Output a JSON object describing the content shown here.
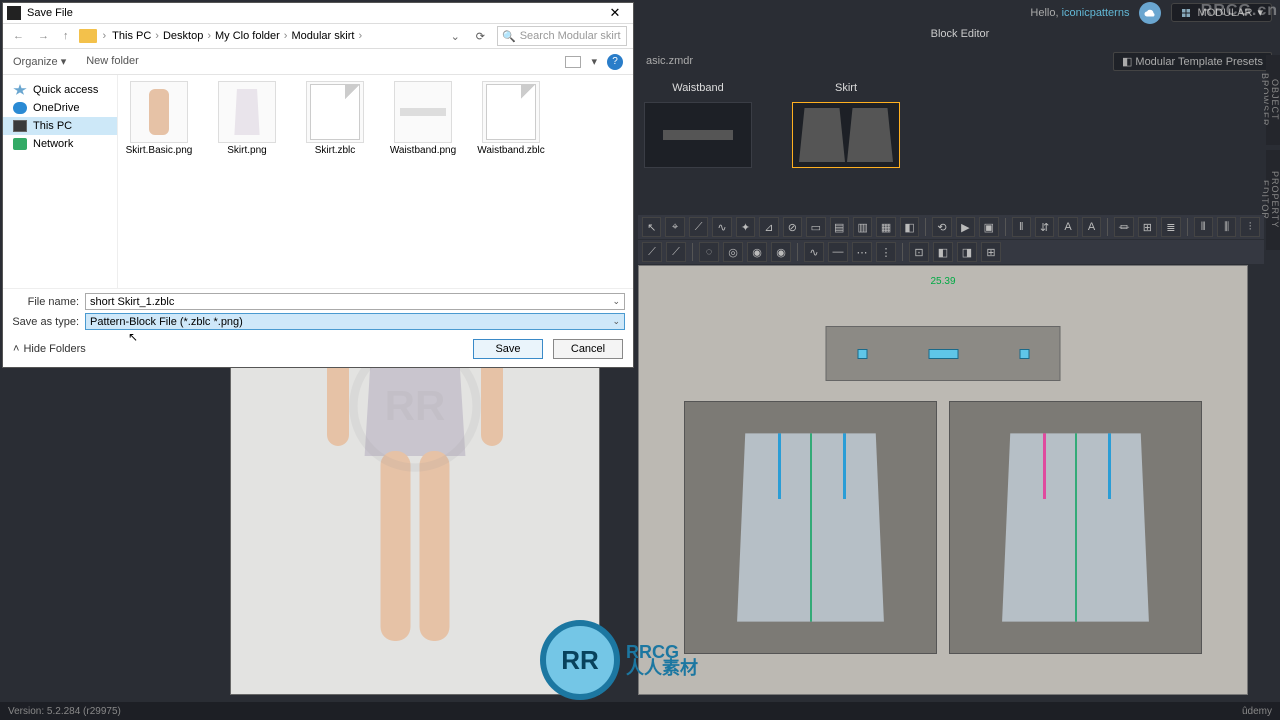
{
  "topbar": {
    "hello_prefix": "Hello, ",
    "username": "iconicpatterns",
    "modular_label": "MODULAR"
  },
  "watermark": {
    "tr": "RRCG.cn",
    "mid_letters": "RR",
    "mid_cn1": "RRCG",
    "mid_cn2": "人人素材"
  },
  "block_editor": {
    "title": "Block Editor",
    "current_file": "asic.zmdr",
    "preset_btn": "Modular Template Presets",
    "side_tabs": {
      "object": "OBJECT BROWSER",
      "property": "PROPERTY EDITOR"
    },
    "categories": [
      {
        "name": "Waistband",
        "selected": false,
        "kind": "waistband"
      },
      {
        "name": "Skirt",
        "selected": true,
        "kind": "skirt"
      }
    ],
    "toolbar_row1": [
      "↖",
      "⌖",
      "⟋",
      "∿",
      "✦",
      "⊿",
      "⊘",
      "▭",
      "▤",
      "▥",
      "▦",
      "◧",
      "⟲",
      "▶",
      "▣",
      "‖",
      "⇵",
      "A",
      "A",
      "⏛",
      "⊞",
      "≣",
      "⫴",
      "⫼",
      "⫶"
    ],
    "toolbar_row2": [
      "⟋",
      "⟋",
      "◌",
      "◎",
      "◉",
      "◉",
      "∿",
      "—",
      "⋯",
      "⋮",
      "⊡",
      "◧",
      "◨",
      "⊞"
    ],
    "measure": "25.39"
  },
  "dialog": {
    "app_icon": "clo-icon",
    "title": "Save File",
    "close": "✕",
    "nav": {
      "back": "←",
      "fwd": "→",
      "up": "↑",
      "expand": "⌄",
      "refresh": "⟳"
    },
    "path": [
      "This PC",
      "Desktop",
      "My Clo folder",
      "Modular skirt"
    ],
    "search_placeholder": "Search Modular skirt",
    "toolbar": {
      "organize": "Organize ▾",
      "newfolder": "New folder",
      "help": "?"
    },
    "sidebar": [
      {
        "label": "Quick access",
        "icon": "star",
        "selected": false
      },
      {
        "label": "OneDrive",
        "icon": "cloud",
        "selected": false
      },
      {
        "label": "This PC",
        "icon": "pc",
        "selected": true
      },
      {
        "label": "Network",
        "icon": "net",
        "selected": false
      }
    ],
    "files": [
      {
        "name": "Skirt.Basic.png",
        "kind": "person"
      },
      {
        "name": "Skirt.png",
        "kind": "skirt"
      },
      {
        "name": "Skirt.zblc",
        "kind": "blank"
      },
      {
        "name": "Waistband.png",
        "kind": "wb"
      },
      {
        "name": "Waistband.zblc",
        "kind": "blank"
      }
    ],
    "filename_label": "File name:",
    "filename_value": "short Skirt_1.zblc",
    "filetype_label": "Save as type:",
    "filetype_value": "Pattern-Block File (*.zblc *.png)",
    "hide_folders": "Hide Folders",
    "save_btn": "Save",
    "cancel_btn": "Cancel"
  },
  "statusbar": {
    "version": "Version: 5.2.284 (r29975)",
    "udemy": "ûdemy"
  }
}
